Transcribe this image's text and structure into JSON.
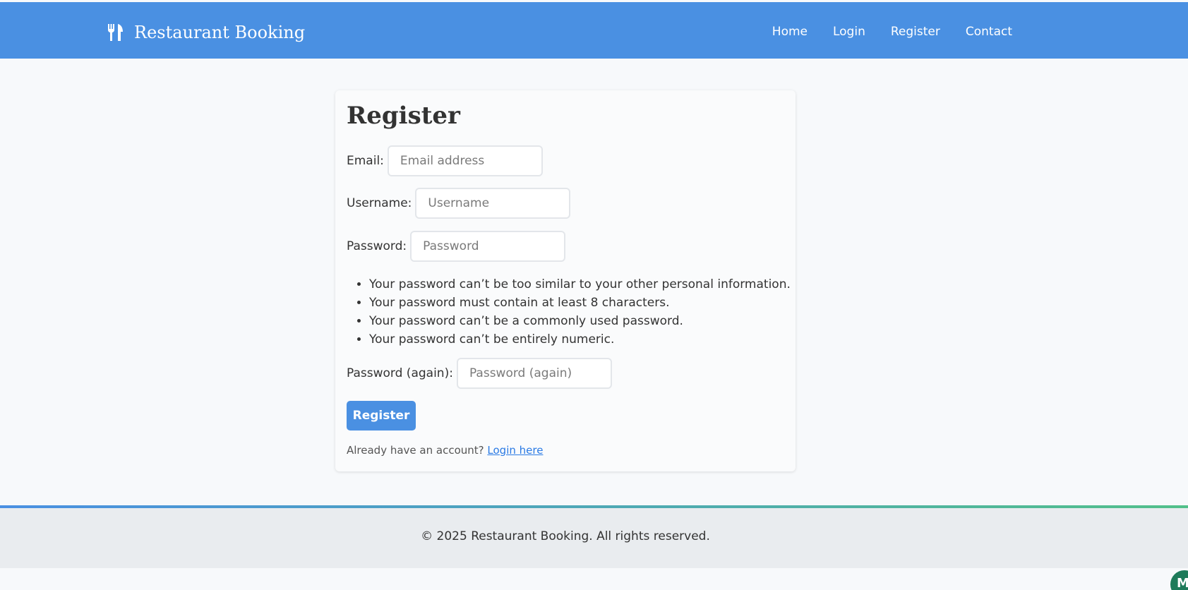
{
  "header": {
    "brand": "Restaurant Booking",
    "brand_icon": "utensils-icon",
    "bg_color": "#4a90e2",
    "nav": [
      {
        "label": "Home"
      },
      {
        "label": "Login"
      },
      {
        "label": "Register"
      },
      {
        "label": "Contact"
      }
    ]
  },
  "form": {
    "title": "Register",
    "email": {
      "label": "Email:",
      "placeholder": "Email address",
      "value": ""
    },
    "username": {
      "label": "Username:",
      "placeholder": "Username",
      "value": ""
    },
    "password": {
      "label": "Password:",
      "placeholder": "Password",
      "value": ""
    },
    "password_rules": [
      "Your password can’t be too similar to your other personal information.",
      "Your password must contain at least 8 characters.",
      "Your password can’t be a commonly used password.",
      "Your password can’t be entirely numeric."
    ],
    "password_again": {
      "label": "Password (again):",
      "placeholder": "Password (again)",
      "value": ""
    },
    "submit_label": "Register",
    "login_prompt": "Already have an account?",
    "login_link": "Login here",
    "accent_color": "#4a90e2"
  },
  "footer": {
    "text": "© 2025 Restaurant Booking. All rights reserved.",
    "gradient_start": "#4a90e2",
    "gradient_end": "#52c08a"
  },
  "corner_badge": {
    "letter": "M",
    "color": "#1e7b5a"
  }
}
